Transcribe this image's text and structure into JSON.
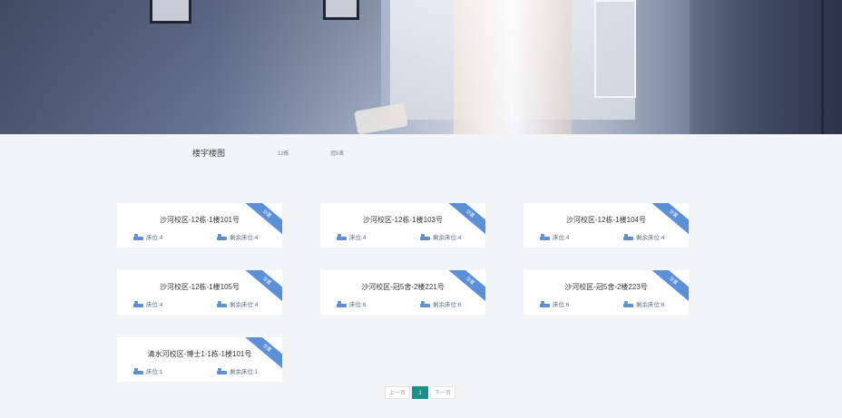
{
  "hero": {
    "alt": "宿舍房间图片"
  },
  "filter": {
    "label": "楼宇楼图",
    "options": [
      "12栋",
      "冠5舍"
    ]
  },
  "rooms": [
    {
      "badge": "空置",
      "title": "沙河校区-12栋-1楼101号",
      "beds": "床位:4",
      "remaining": "剩余床位:4"
    },
    {
      "badge": "空置",
      "title": "沙河校区-12栋-1楼103号",
      "beds": "床位:4",
      "remaining": "剩余床位:4"
    },
    {
      "badge": "空置",
      "title": "沙河校区-12栋-1楼104号",
      "beds": "床位:4",
      "remaining": "剩余床位:4"
    },
    {
      "badge": "空置",
      "title": "沙河校区-12栋-1楼105号",
      "beds": "床位:4",
      "remaining": "剩余床位:4"
    },
    {
      "badge": "空置",
      "title": "沙河校区-冠5舍-2楼221号",
      "beds": "床位:6",
      "remaining": "剩余床位:6"
    },
    {
      "badge": "空置",
      "title": "沙河校区-冠5舍-2楼223号",
      "beds": "床位:6",
      "remaining": "剩余床位:6"
    },
    {
      "badge": "空置",
      "title": "清水河校区-博士1-1栋-1楼101号",
      "beds": "床位:1",
      "remaining": "剩余床位:1"
    }
  ],
  "pagination": {
    "prev": "上一页",
    "current": "1",
    "next": "下一页"
  },
  "colors": {
    "accent": "#5b8fd8",
    "pager_active": "#1f8f86"
  },
  "icons": {
    "bed": "bed-icon"
  }
}
